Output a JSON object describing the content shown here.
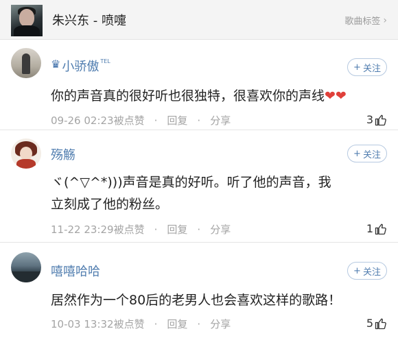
{
  "header": {
    "title": "朱兴东 - 喷嚏",
    "tag_label": "歌曲标签",
    "tag_chevron": "›"
  },
  "follow_label": "关注",
  "follow_plus": "+",
  "comments": [
    {
      "username": "小骄傲",
      "crown_icon": "♛",
      "badge": "TEL",
      "text": "你的声音真的很好听也很独特，很喜欢你的声线",
      "hearts": "❤❤",
      "timestamp": "09-26 02:23",
      "like_action": "被点赞",
      "reply": "回复",
      "share": "分享",
      "likes": "3"
    },
    {
      "username": "殇觞",
      "text_line1": "ヾ(^▽^*)))声音是真的好听。听了他的声音，我",
      "text_line2": "立刻成了他的粉丝。",
      "timestamp": "11-22 23:29",
      "like_action": "被点赞",
      "reply": "回复",
      "share": "分享",
      "likes": "1"
    },
    {
      "username": "嘻嘻哈哈",
      "text": "居然作为一个80后的老男人也会喜欢这样的歌路！",
      "timestamp": "10-03 13:32",
      "like_action": "被点赞",
      "reply": "回复",
      "share": "分享",
      "likes": "5"
    }
  ],
  "separator": "·",
  "colors": {
    "username": "#507daf",
    "meta": "#a4a4a4",
    "heart": "#e0403a"
  }
}
